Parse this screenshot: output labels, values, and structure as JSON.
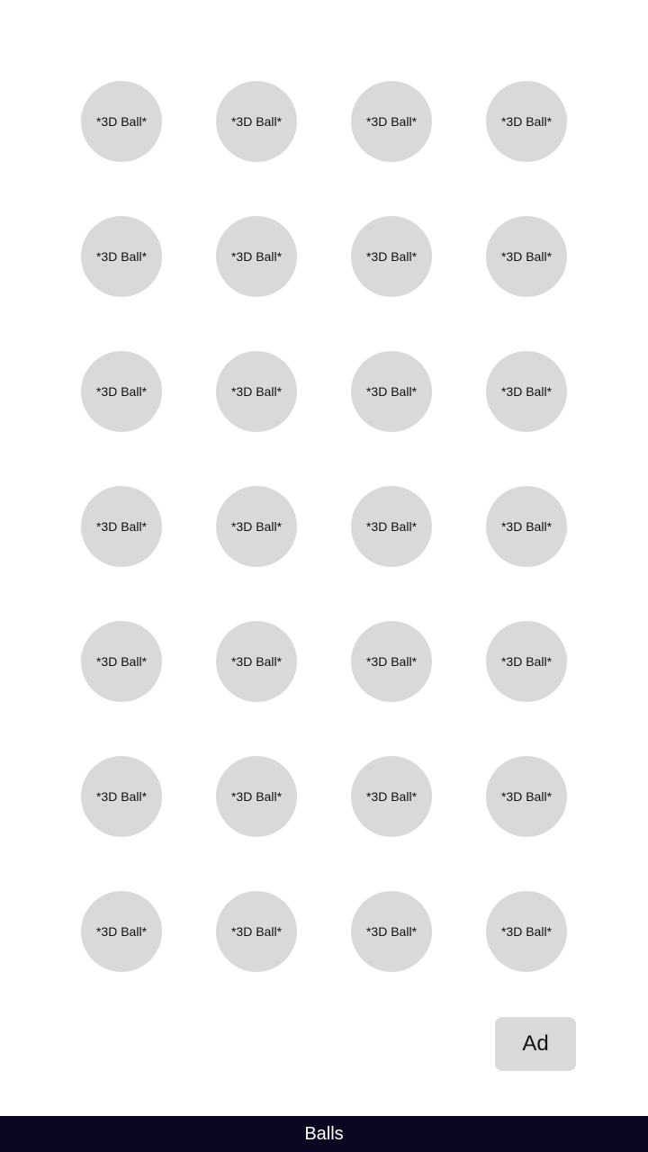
{
  "ball_grid": {
    "rows": [
      [
        "*3D Ball*",
        "*3D Ball*",
        "*3D Ball*",
        "*3D Ball*"
      ],
      [
        "*3D Ball*",
        "*3D Ball*",
        "*3D Ball*",
        "*3D Ball*"
      ],
      [
        "*3D Ball*",
        "*3D Ball*",
        "*3D Ball*",
        "*3D Ball*"
      ],
      [
        "*3D Ball*",
        "*3D Ball*",
        "*3D Ball*",
        "*3D Ball*"
      ],
      [
        "*3D Ball*",
        "*3D Ball*",
        "*3D Ball*",
        "*3D Ball*"
      ],
      [
        "*3D Ball*",
        "*3D Ball*",
        "*3D Ball*",
        "*3D Ball*"
      ],
      [
        "*3D Ball*",
        "*3D Ball*",
        "*3D Ball*",
        "*3D Ball*"
      ]
    ]
  },
  "ad_button": {
    "label": "Ad"
  },
  "bottom_bar": {
    "title": "Balls"
  },
  "colors": {
    "ball": "#d9d9d9",
    "bar_background": "#0d0620",
    "bar_text": "#ffffff"
  }
}
